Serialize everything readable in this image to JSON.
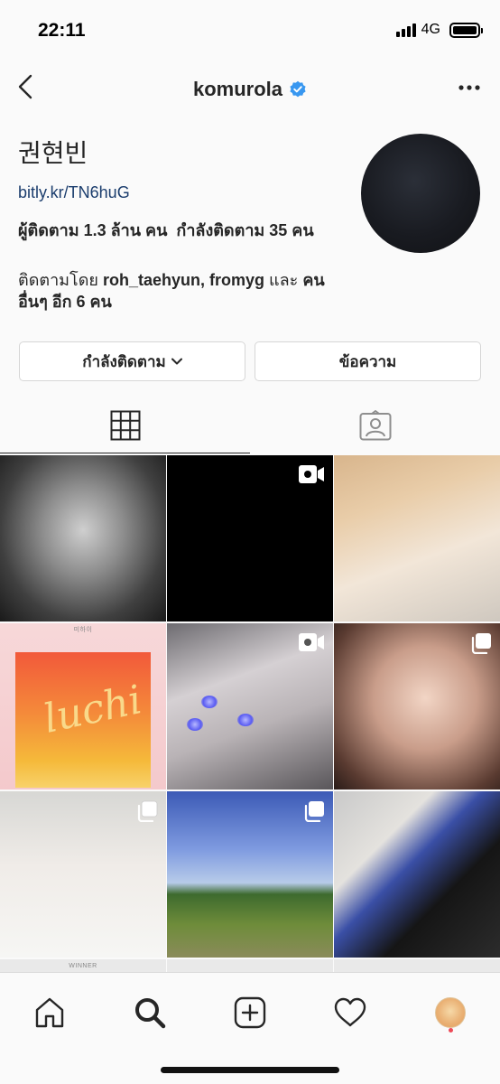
{
  "status_bar": {
    "time": "22:11",
    "network": "4G"
  },
  "header": {
    "username": "komurola",
    "verified": true
  },
  "profile": {
    "display_name": "권현빈",
    "link": "bitly.kr/TN6huG",
    "followers_text": "ผู้ติดตาม 1.3 ล้าน คน",
    "following_text": "กำลังติดตาม 35 คน",
    "followed_by_prefix": "ติดตามโดย",
    "followed_by_users": "roh_taehyun, fromyg",
    "followed_by_and": "และ",
    "followed_by_others": "คนอื่นๆ อีก 6 คน"
  },
  "actions": {
    "following_label": "กำลังติดตาม",
    "message_label": "ข้อความ"
  },
  "tabs": [
    {
      "icon": "grid-icon",
      "active": true
    },
    {
      "icon": "tagged-icon",
      "active": false
    }
  ],
  "grid": {
    "album_caption": "미하이",
    "bottom_caption": "WINNER",
    "posts": [
      {
        "type": "photo"
      },
      {
        "type": "video"
      },
      {
        "type": "photo"
      },
      {
        "type": "photo"
      },
      {
        "type": "video"
      },
      {
        "type": "carousel"
      },
      {
        "type": "carousel"
      },
      {
        "type": "carousel"
      },
      {
        "type": "photo"
      }
    ]
  },
  "bottom_nav": [
    "home-icon",
    "search-icon",
    "new-post-icon",
    "activity-icon",
    "profile-icon"
  ]
}
